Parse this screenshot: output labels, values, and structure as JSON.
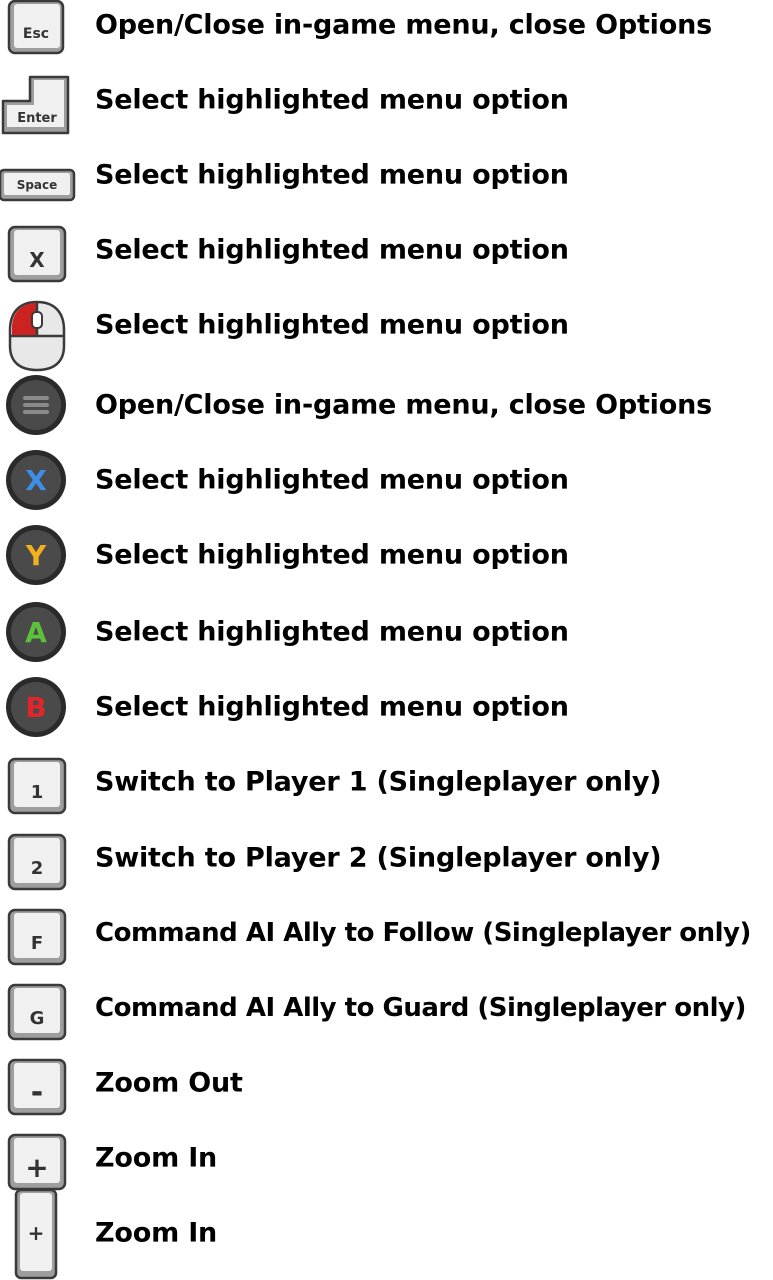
{
  "colors": {
    "key_face": "#f0f0f0",
    "key_border": "#3a3a3a",
    "pad_button_body": "#3c3c3c",
    "pad_x": "#3d8ee6",
    "pad_y": "#f2b01e",
    "pad_a": "#5cc23a",
    "pad_b": "#e0262b",
    "mouse_left_button": "#cc2222"
  },
  "bindings": [
    {
      "icon": "esc-key-icon",
      "key_text": "Esc",
      "action": "Open/Close in-game menu, close Options"
    },
    {
      "icon": "enter-key-icon",
      "key_text": "Enter",
      "action": "Select highlighted menu option"
    },
    {
      "icon": "space-key-icon",
      "key_text": "Space",
      "action": "Select highlighted menu option"
    },
    {
      "icon": "x-key-icon",
      "key_text": "X",
      "action": "Select highlighted menu option"
    },
    {
      "icon": "mouse-left-click-icon",
      "key_text": "",
      "action": "Select highlighted menu option"
    },
    {
      "icon": "gamepad-menu-button-icon",
      "key_text": "",
      "action": "Open/Close in-game menu, close Options"
    },
    {
      "icon": "gamepad-x-button-icon",
      "key_text": "X",
      "action": "Select highlighted menu option"
    },
    {
      "icon": "gamepad-y-button-icon",
      "key_text": "Y",
      "action": "Select highlighted menu option"
    },
    {
      "icon": "gamepad-a-button-icon",
      "key_text": "A",
      "action": "Select highlighted menu option"
    },
    {
      "icon": "gamepad-b-button-icon",
      "key_text": "B",
      "action": "Select highlighted menu option"
    },
    {
      "icon": "1-key-icon",
      "key_text": "1",
      "action": "Switch to Player 1 (Singleplayer only)"
    },
    {
      "icon": "2-key-icon",
      "key_text": "2",
      "action": "Switch to Player 2 (Singleplayer only)"
    },
    {
      "icon": "f-key-icon",
      "key_text": "F",
      "action": "Command AI Ally to Follow (Singleplayer only)"
    },
    {
      "icon": "g-key-icon",
      "key_text": "G",
      "action": "Command AI Ally to Guard (Singleplayer only)"
    },
    {
      "icon": "minus-key-icon",
      "key_text": "-",
      "action": "Zoom Out"
    },
    {
      "icon": "plus-key-icon",
      "key_text": "+",
      "action": "Zoom In"
    },
    {
      "icon": "numpad-plus-key-icon",
      "key_text": "+",
      "action": "Zoom In"
    }
  ]
}
